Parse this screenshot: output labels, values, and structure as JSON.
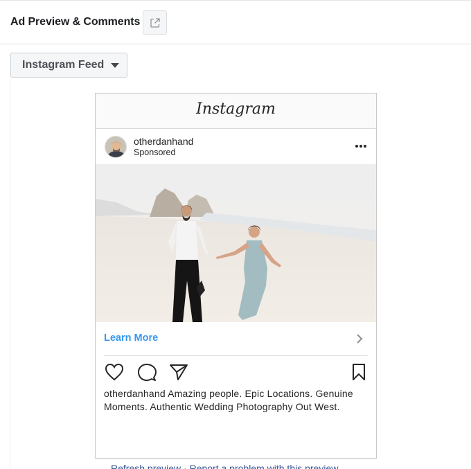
{
  "header": {
    "title": "Ad Preview & Comments",
    "external_icon": "external-link-icon"
  },
  "placement": {
    "selected": "Instagram Feed",
    "icon": "caret-down-icon"
  },
  "instagram_post": {
    "wordmark": "Instagram",
    "username": "otherdanhand",
    "sponsored_label": "Sponsored",
    "more_icon": "more-dots-icon",
    "cta_label": "Learn More",
    "cta_color": "#3897f0",
    "caption_user": "otherdanhand",
    "caption_text": " Amazing people. Epic Locations. Genuine Moments. Authentic Wedding Photography Out West.",
    "action_icons": [
      "heart-icon",
      "comment-icon",
      "share-icon",
      "bookmark-icon"
    ]
  },
  "footer": {
    "link_text": "Refresh preview · Report a problem with this preview"
  }
}
